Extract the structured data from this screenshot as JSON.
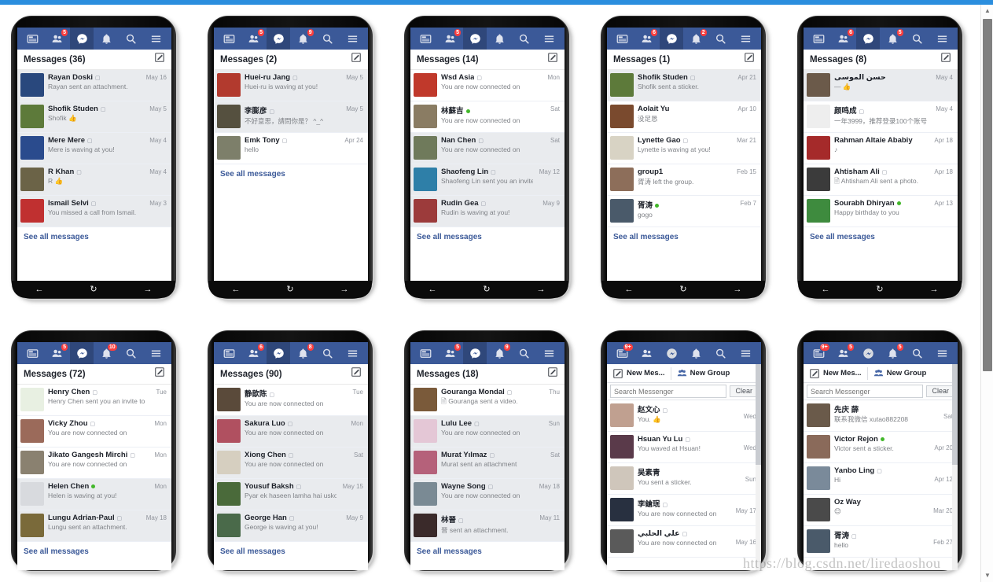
{
  "browser": {
    "top_strip_color": "#2b8ede",
    "scrollbar": {
      "up_arrow": "▲",
      "down_arrow": "▼"
    }
  },
  "watermark": "https://blog.csdn.net/liredaoshou",
  "icons": {
    "feed": "feed-icon",
    "friends": "friends-icon",
    "messenger": "messenger-icon",
    "bell": "notifications-bell-icon",
    "search": "search-icon",
    "menu": "hamburger-menu-icon",
    "compose": "compose-message-icon",
    "new_group": "new-group-icon",
    "back": "←",
    "refresh": "↻",
    "forward": "→"
  },
  "labels": {
    "see_all": "See all messages",
    "new_message": "New Mes...",
    "new_group": "New Group",
    "search_placeholder": "Search Messenger",
    "clear": "Clear"
  },
  "colors": {
    "fb_blue": "#3b5998",
    "badge_red": "#fa3e3e",
    "online_green": "#42b72a",
    "unread_bg": "#e9ebee",
    "link_blue": "#3b5998"
  },
  "phones": [
    {
      "id": "phone-1",
      "variant": "messages",
      "header": "Messages (36)",
      "badges": {
        "feed": "",
        "friends": "5",
        "bell": ""
      },
      "conversations": [
        {
          "name": "Rayan Doski",
          "mobile": true,
          "snippet": "Rayan sent an attachment.",
          "date": "May 16",
          "unread": true,
          "online": false,
          "avatar": "#29487d"
        },
        {
          "name": "Shofik Studen",
          "mobile": true,
          "snippet": "Shofik 👍",
          "date": "May 5",
          "unread": true,
          "online": false,
          "avatar": "#5d7a3a"
        },
        {
          "name": "Mere Mere",
          "mobile": true,
          "snippet": "Mere is waving at you!",
          "date": "May 4",
          "unread": true,
          "online": false,
          "avatar": "#2a4b8d"
        },
        {
          "name": "R Khan",
          "mobile": true,
          "snippet": "R 👍",
          "date": "May 4",
          "unread": true,
          "online": false,
          "avatar": "#6b6347"
        },
        {
          "name": "Ismail Selvi",
          "mobile": true,
          "snippet": "You missed a call from Ismail.",
          "date": "May 3",
          "unread": true,
          "online": false,
          "avatar": "#c03030"
        }
      ]
    },
    {
      "id": "phone-2",
      "variant": "messages",
      "header": "Messages (2)",
      "badges": {
        "feed": "",
        "friends": "5",
        "bell": "9"
      },
      "conversations": [
        {
          "name": "Huei-ru Jang",
          "mobile": true,
          "snippet": "Huei-ru is waving at you!",
          "date": "May 5",
          "unread": true,
          "online": false,
          "avatar": "#b23a2e"
        },
        {
          "name": "李膨彦",
          "mobile": true,
          "snippet": "不好意思，請問你是？ ^_^",
          "date": "May 5",
          "unread": true,
          "online": false,
          "avatar": "#55503f"
        },
        {
          "name": "Emk Tony",
          "mobile": true,
          "snippet": "hello",
          "date": "Apr 24",
          "unread": false,
          "online": false,
          "avatar": "#7d7f6a"
        }
      ]
    },
    {
      "id": "phone-3",
      "variant": "messages",
      "header": "Messages (14)",
      "badges": {
        "feed": "",
        "friends": "5",
        "bell": ""
      },
      "conversations": [
        {
          "name": "Wsd Asia",
          "mobile": true,
          "snippet": "You are now connected on",
          "date": "Mon",
          "unread": false,
          "online": false,
          "avatar": "#c0392b"
        },
        {
          "name": "林蘇吉",
          "mobile": false,
          "snippet": "You are now connected on",
          "date": "Sat",
          "unread": false,
          "online": true,
          "avatar": "#8a7c63"
        },
        {
          "name": "Nan Chen",
          "mobile": true,
          "snippet": "You are now connected on",
          "date": "Sat",
          "unread": true,
          "online": false,
          "avatar": "#6f7a5b"
        },
        {
          "name": "Shaofeng Lin",
          "mobile": true,
          "snippet": "Shaofeng Lin sent you an invite to",
          "date": "May 12",
          "unread": true,
          "online": false,
          "avatar": "#2e7fa8"
        },
        {
          "name": "Rudin Gea",
          "mobile": true,
          "snippet": "Rudin is waving at you!",
          "date": "May 9",
          "unread": true,
          "online": false,
          "avatar": "#9c3b3b"
        }
      ]
    },
    {
      "id": "phone-4",
      "variant": "messages",
      "header": "Messages (1)",
      "badges": {
        "feed": "",
        "friends": "6",
        "bell": "2"
      },
      "conversations": [
        {
          "name": "Shofik Studen",
          "mobile": true,
          "snippet": "Shofik sent a sticker.",
          "date": "Apr 21",
          "unread": true,
          "online": false,
          "avatar": "#5d7a3a"
        },
        {
          "name": "Aolait Yu",
          "mobile": false,
          "snippet": "没足恳",
          "date": "Apr 10",
          "unread": false,
          "online": false,
          "avatar": "#7a4a2e"
        },
        {
          "name": "Lynette Gao",
          "mobile": true,
          "snippet": "Lynette is waving at you!",
          "date": "Mar 21",
          "unread": false,
          "online": false,
          "avatar": "#d8d3c4"
        },
        {
          "name": "group1",
          "mobile": false,
          "snippet": "胥涛 left the group.",
          "date": "Feb 15",
          "unread": false,
          "online": false,
          "avatar": "#8d6e5a"
        },
        {
          "name": "胥涛",
          "mobile": false,
          "snippet": "gogo",
          "date": "Feb 7",
          "unread": false,
          "online": true,
          "avatar": "#4a5a6a"
        }
      ]
    },
    {
      "id": "phone-5",
      "variant": "messages",
      "header": "Messages (8)",
      "badges": {
        "feed": "",
        "friends": "6",
        "bell": "5"
      },
      "conversations": [
        {
          "name": "حسن الموسى",
          "mobile": false,
          "snippet": "— 👍",
          "date": "May 4",
          "unread": true,
          "online": false,
          "avatar": "#6b5a4a"
        },
        {
          "name": "颜鸣成",
          "mobile": true,
          "snippet": "一年3999，推荐登录100个账号",
          "date": "May 4",
          "unread": false,
          "online": false,
          "avatar": "#eeeeee"
        },
        {
          "name": "Rahman Altaie Ababiy",
          "mobile": false,
          "snippet": "♪",
          "date": "Apr 18",
          "unread": false,
          "online": false,
          "avatar": "#a52a2a"
        },
        {
          "name": "Ahtisham Ali",
          "mobile": true,
          "snippet": "🗎 Ahtisham Ali sent a photo.",
          "date": "Apr 18",
          "unread": false,
          "online": false,
          "avatar": "#3b3b3b"
        },
        {
          "name": "Sourabh Dhiryan",
          "mobile": false,
          "snippet": "Happy birthday to you",
          "date": "Apr 13",
          "unread": false,
          "online": true,
          "avatar": "#3e8b3e"
        }
      ]
    },
    {
      "id": "phone-6",
      "variant": "messages",
      "header": "Messages (72)",
      "badges": {
        "feed": "",
        "friends": "5",
        "bell": "10"
      },
      "conversations": [
        {
          "name": "Henry Chen",
          "mobile": true,
          "snippet": "Henry Chen sent you an invite to",
          "date": "Tue",
          "unread": false,
          "online": false,
          "avatar": "#e8f0e2"
        },
        {
          "name": "Vicky Zhou",
          "mobile": true,
          "snippet": "You are now connected on",
          "date": "Mon",
          "unread": false,
          "online": false,
          "avatar": "#9b6a5a"
        },
        {
          "name": "Jikato Gangesh Mirchi",
          "mobile": true,
          "snippet": "You are now connected on",
          "date": "Mon",
          "unread": false,
          "online": false,
          "avatar": "#8a8170"
        },
        {
          "name": "Helen Chen",
          "mobile": false,
          "snippet": "Helen is waving at you!",
          "date": "Mon",
          "unread": true,
          "online": true,
          "avatar": "#d8dade"
        },
        {
          "name": "Lungu Adrian-Paul",
          "mobile": true,
          "snippet": "Lungu sent an attachment.",
          "date": "May 18",
          "unread": true,
          "online": false,
          "avatar": "#7a6a3a"
        }
      ]
    },
    {
      "id": "phone-7",
      "variant": "messages",
      "header": "Messages (90)",
      "badges": {
        "feed": "",
        "friends": "6",
        "bell": "8"
      },
      "conversations": [
        {
          "name": "静歆陈",
          "mobile": true,
          "snippet": "You are now connected on",
          "date": "Tue",
          "unread": false,
          "online": false,
          "avatar": "#5a4a3a"
        },
        {
          "name": "Sakura Luo",
          "mobile": true,
          "snippet": "You are now connected on",
          "date": "Mon",
          "unread": true,
          "online": false,
          "avatar": "#b05060"
        },
        {
          "name": "Xiong Chen",
          "mobile": true,
          "snippet": "You are now connected on",
          "date": "Sat",
          "unread": true,
          "online": false,
          "avatar": "#d6cfc0"
        },
        {
          "name": "Yousuf Baksh",
          "mobile": true,
          "snippet": "Pyar ek haseen lamha hai usko",
          "date": "May 15",
          "unread": true,
          "online": false,
          "avatar": "#4a6a3a"
        },
        {
          "name": "George Han",
          "mobile": true,
          "snippet": "George is waving at you!",
          "date": "May 9",
          "unread": true,
          "online": false,
          "avatar": "#4a6a4a"
        }
      ]
    },
    {
      "id": "phone-8",
      "variant": "messages",
      "header": "Messages (18)",
      "badges": {
        "feed": "",
        "friends": "5",
        "bell": "9"
      },
      "conversations": [
        {
          "name": "Gouranga Mondal",
          "mobile": true,
          "snippet": "🗎 Gouranga sent a video.",
          "date": "Thu",
          "unread": false,
          "online": false,
          "avatar": "#7a5a3a"
        },
        {
          "name": "Lulu Lee",
          "mobile": true,
          "snippet": "You are now connected on",
          "date": "Sun",
          "unread": true,
          "online": false,
          "avatar": "#e4c7d6"
        },
        {
          "name": "Murat Yılmaz",
          "mobile": true,
          "snippet": "Murat sent an attachment",
          "date": "Sat",
          "unread": true,
          "online": false,
          "avatar": "#b5617a"
        },
        {
          "name": "Wayne Song",
          "mobile": true,
          "snippet": "You are now connected on",
          "date": "May 18",
          "unread": true,
          "online": false,
          "avatar": "#7a8a94"
        },
        {
          "name": "林晉",
          "mobile": true,
          "snippet": "晉 sent an attachment.",
          "date": "May 11",
          "unread": true,
          "online": false,
          "avatar": "#3a2a2a"
        }
      ]
    },
    {
      "id": "phone-9",
      "variant": "messenger",
      "badges": {
        "feed": "9+",
        "friends": "",
        "bell": ""
      },
      "conversations": [
        {
          "name": "赵文心",
          "mobile": true,
          "snippet": "You. 👍",
          "date": "Wed",
          "unread": false,
          "online": false,
          "avatar": "#c0a090"
        },
        {
          "name": "Hsuan Yu Lu",
          "mobile": true,
          "snippet": "You waved at Hsuan!",
          "date": "Wed",
          "unread": false,
          "online": false,
          "avatar": "#5a3a4a"
        },
        {
          "name": "吴素青",
          "mobile": false,
          "snippet": "You sent a sticker.",
          "date": "Sun",
          "unread": false,
          "online": false,
          "avatar": "#cfc6bb"
        },
        {
          "name": "李鎗珉",
          "mobile": true,
          "snippet": "You are now connected on",
          "date": "May 17",
          "unread": false,
          "online": false,
          "avatar": "#283040"
        },
        {
          "name": "علي الحلبي",
          "mobile": true,
          "snippet": "You are now connected on",
          "date": "May 16",
          "unread": false,
          "online": false,
          "avatar": "#5a5a5a"
        }
      ]
    },
    {
      "id": "phone-10",
      "variant": "messenger",
      "badges": {
        "feed": "9+",
        "friends": "5",
        "bell": "5"
      },
      "conversations": [
        {
          "name": "先庆 薛",
          "mobile": false,
          "snippet": "联系我微信 xutao882208",
          "date": "Sat",
          "unread": false,
          "online": false,
          "avatar": "#6a5a4a"
        },
        {
          "name": "Victor Rejon",
          "mobile": false,
          "snippet": "Victor sent a sticker.",
          "date": "Apr 20",
          "unread": false,
          "online": true,
          "avatar": "#8a6a5a"
        },
        {
          "name": "Yanbo Ling",
          "mobile": true,
          "snippet": "Hi",
          "date": "Apr 12",
          "unread": false,
          "online": false,
          "avatar": "#7a8a9a"
        },
        {
          "name": "Oz Way",
          "mobile": false,
          "snippet": "😊",
          "date": "Mar 20",
          "unread": false,
          "online": false,
          "avatar": "#4a4a4a"
        },
        {
          "name": "胥涛",
          "mobile": true,
          "snippet": "hello",
          "date": "Feb 27",
          "unread": false,
          "online": false,
          "avatar": "#4a5a6a"
        }
      ]
    }
  ]
}
